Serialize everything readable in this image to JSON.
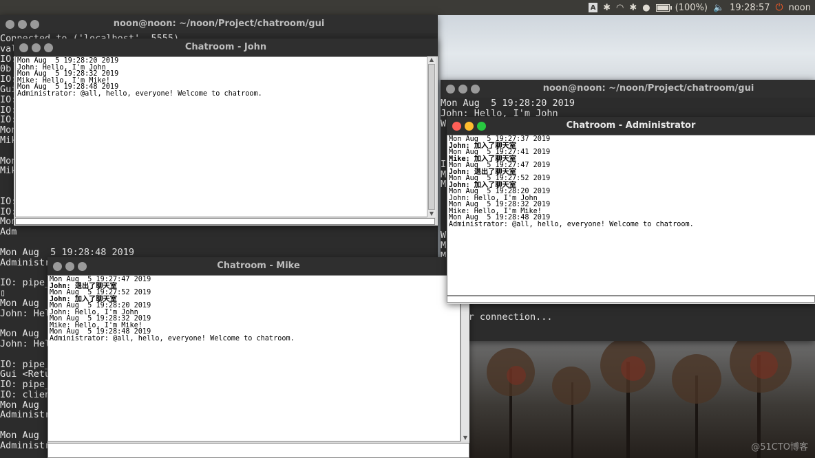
{
  "topbar": {
    "keyboard_indicator": "A",
    "battery_text": "(100%)",
    "battery_level": 1.0,
    "clock": "19:28:57",
    "user": "noon"
  },
  "watermark": "@51CTO博客",
  "terminal_left": {
    "title": "noon@noon: ~/noon/Project/chatroom/gui",
    "lines": [
      "Connected to ('localhost', 5555)",
      "val",
      "IO:",
      "0b",
      "IO:",
      "Gui",
      "IO:",
      "IO:",
      "IO:",
      "Mon",
      "Mik",
      "",
      "Mon",
      "Mik",
      "",
      "",
      "IO:",
      "IO:",
      "Mon",
      "Adm",
      "",
      "Mon Aug  5 19:28:48 2019",
      "Administrator: @all, hello, everyone! Welcome to chatroom.",
      "",
      "IO: pipe_",
      "▯",
      "Mon Aug",
      "John: Hel",
      "",
      "Mon Aug",
      "John: Hel",
      "",
      "IO: pipe_",
      "Gui <Retu",
      "IO: pipe_",
      "IO: clien",
      "Mon Aug",
      "Administr",
      "",
      "Mon Aug",
      "Administr",
      "",
      "IO: pipe_"
    ]
  },
  "terminal_right": {
    "title": "noon@noon: ~/noon/Project/chatroom/gui",
    "lines": [
      "Mon Aug  5 19:28:20 2019",
      "John: Hello, I'm John",
      "W",
      "",
      "",
      "",
      "I",
      "M",
      "M",
      "",
      "",
      "",
      "",
      "W",
      "M",
      "M",
      "",
      "",
      "",
      "nistrator: @all, hello, everyone! Welcome to chatroom.",
      "",
      "ng for connection..."
    ]
  },
  "chat_john": {
    "title": "Chatroom - John",
    "messages": [
      {
        "text": "Mon Aug  5 19:28:20 2019",
        "bold": false
      },
      {
        "text": "John: Hello, I'm John",
        "bold": false
      },
      {
        "text": "Mon Aug  5 19:28:32 2019",
        "bold": false
      },
      {
        "text": "Mike: Hello, I'm Mike!",
        "bold": false
      },
      {
        "text": "Mon Aug  5 19:28:48 2019",
        "bold": false
      },
      {
        "text": "Administrator: @all, hello, everyone! Welcome to chatroom.",
        "bold": false
      }
    ]
  },
  "chat_admin": {
    "title": "Chatroom - Administrator",
    "messages": [
      {
        "text": "Mon Aug  5 19:27:37 2019",
        "bold": false
      },
      {
        "text": "John: 加入了聊天室",
        "bold": true
      },
      {
        "text": "Mon Aug  5 19:27:41 2019",
        "bold": false
      },
      {
        "text": "Mike: 加入了聊天室",
        "bold": true
      },
      {
        "text": "Mon Aug  5 19:27:47 2019",
        "bold": false
      },
      {
        "text": "John: 退出了聊天室",
        "bold": true
      },
      {
        "text": "Mon Aug  5 19:27:52 2019",
        "bold": false
      },
      {
        "text": "John: 加入了聊天室",
        "bold": true
      },
      {
        "text": "Mon Aug  5 19:28:20 2019",
        "bold": false
      },
      {
        "text": "John: Hello, I'm John",
        "bold": false
      },
      {
        "text": "Mon Aug  5 19:28:32 2019",
        "bold": false
      },
      {
        "text": "Mike: Hello, I'm Mike!",
        "bold": false
      },
      {
        "text": "Mon Aug  5 19:28:48 2019",
        "bold": false
      },
      {
        "text": "Administrator: @all, hello, everyone! Welcome to chatroom.",
        "bold": false
      }
    ]
  },
  "chat_mike": {
    "title": "Chatroom - Mike",
    "messages": [
      {
        "text": "Mon Aug  5 19:27:47 2019",
        "bold": false
      },
      {
        "text": "John: 退出了聊天室",
        "bold": true
      },
      {
        "text": "Mon Aug  5 19:27:52 2019",
        "bold": false
      },
      {
        "text": "John: 加入了聊天室",
        "bold": true
      },
      {
        "text": "Mon Aug  5 19:28:20 2019",
        "bold": false
      },
      {
        "text": "John: Hello, I'm John",
        "bold": false
      },
      {
        "text": "Mon Aug  5 19:28:32 2019",
        "bold": false
      },
      {
        "text": "Mike: Hello, I'm Mike!",
        "bold": false
      },
      {
        "text": "Mon Aug  5 19:28:48 2019",
        "bold": false
      },
      {
        "text": "Administrator: @all, hello, everyone! Welcome to chatroom.",
        "bold": false
      }
    ]
  }
}
